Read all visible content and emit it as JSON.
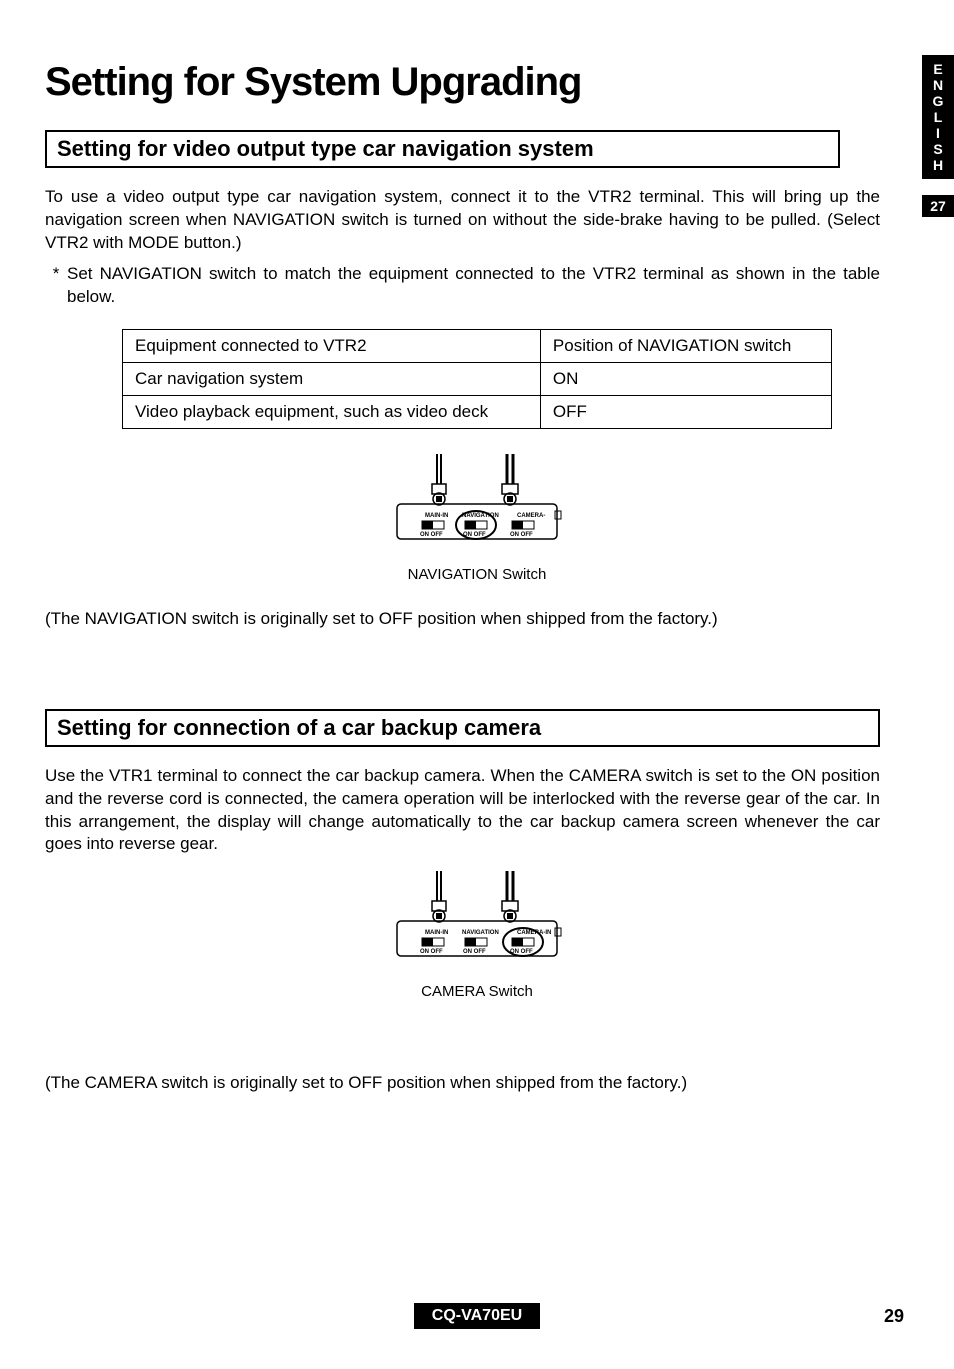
{
  "sideTab": {
    "lang": "ENGLISH",
    "pageSide": "27"
  },
  "title": "Setting for System Upgrading",
  "section1": {
    "heading": "Setting for video output type car navigation system",
    "para": "To use a video output type car navigation system, connect it to the VTR2 terminal. This will bring up the navigation screen when NAVIGATION switch is turned on without the side-brake having to be pulled. (Select VTR2 with MODE button.)",
    "note": "Set NAVIGATION switch to match the equipment connected to the VTR2 terminal as shown in the table below.",
    "table": {
      "h1": "Equipment connected to VTR2",
      "h2": "Position of NAVIGATION switch",
      "r1c1": "Car navigation system",
      "r1c2": "ON",
      "r2c1": "Video playback equipment, such as video deck",
      "r2c2": "OFF"
    },
    "figCaption": "NAVIGATION Switch",
    "footnote": "(The NAVIGATION switch is originally set to OFF position when shipped from the factory.)",
    "diagram": {
      "l1": "MAIN-IN",
      "l2": "NAVIGATION",
      "l3": "CAMERA-IN",
      "sw": "ON OFF",
      "circle": "nav"
    }
  },
  "section2": {
    "heading": "Setting for connection of a car backup camera",
    "para": "Use the VTR1 terminal to connect the car backup camera. When the CAMERA switch is set to the ON position and the reverse cord is connected, the camera operation will be interlocked with the reverse gear of the car. In this arrangement, the display will change automatically to the car backup camera screen whenever the car goes into reverse gear.",
    "figCaption": "CAMERA Switch",
    "footnote": "(The CAMERA switch is originally set to OFF position when shipped from the factory.)",
    "diagram": {
      "l1": "MAIN-IN",
      "l2": "NAVIGATION",
      "l3": "CAMERA-IN",
      "sw": "ON OFF",
      "circle": "cam"
    }
  },
  "footer": {
    "model": "CQ-VA70EU",
    "page": "29"
  }
}
